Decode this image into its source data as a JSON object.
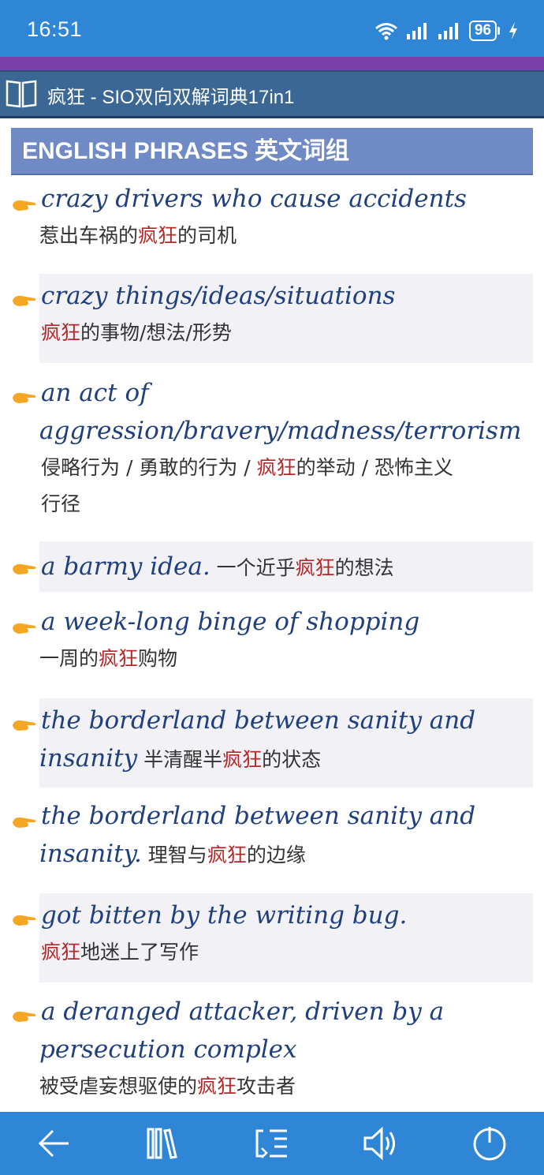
{
  "status": {
    "time": "16:51",
    "battery": "96"
  },
  "dictbar": {
    "title": "疯狂 - SIO双向双解词典17in1"
  },
  "section": {
    "header": "ENGLISH PHRASES 英文词组"
  },
  "entries": [
    {
      "en1": "crazy drivers who cause accidents",
      "zh_pre": "惹出车祸的",
      "zh_hl": "疯狂",
      "zh_post": "的司机"
    },
    {
      "en1": "crazy things/ideas/situations",
      "zh_pre": "",
      "zh_hl": "疯狂",
      "zh_post": "的事物/想法/形势"
    },
    {
      "en1": "an act of",
      "en2": "aggression/bravery/madness/terrorism",
      "zh_pre": "侵略行为 / 勇敢的行为 / ",
      "zh_hl": "疯狂",
      "zh_post": "的举动 / 恐怖主义",
      "zh2": "行径"
    },
    {
      "en1": "a barmy idea.",
      "zh_pre": " 一个近乎",
      "zh_hl": "疯狂",
      "zh_post": "的想法"
    },
    {
      "en1": "a week-long binge of shopping",
      "zh_pre": "一周的",
      "zh_hl": "疯狂",
      "zh_post": "购物"
    },
    {
      "en1": "the borderland between sanity and",
      "en2": "insanity",
      "zh_pre": " 半清醒半",
      "zh_hl": "疯狂",
      "zh_post": "的状态"
    },
    {
      "en1": "the borderland between sanity and",
      "en2": "insanity.",
      "zh_pre": " 理智与",
      "zh_hl": "疯狂",
      "zh_post": "的边缘"
    },
    {
      "en1": "got bitten by the writing bug.",
      "zh_pre": "",
      "zh_hl": "疯狂",
      "zh_post": "地迷上了写作"
    },
    {
      "en1": "a deranged attacker, driven by a",
      "en2": "persecution complex",
      "zh_pre": "被受虐妄想驱使的",
      "zh_hl": "疯狂",
      "zh_post": "攻击者"
    }
  ],
  "bottom_nav": [
    "back-arrow-icon",
    "library-icon",
    "list-icon",
    "speaker-icon",
    "power-icon"
  ],
  "colors": {
    "accent": "#2f86d6",
    "header": "#6f8ac4",
    "english": "#1f3f7d",
    "highlight": "#b5282a"
  }
}
